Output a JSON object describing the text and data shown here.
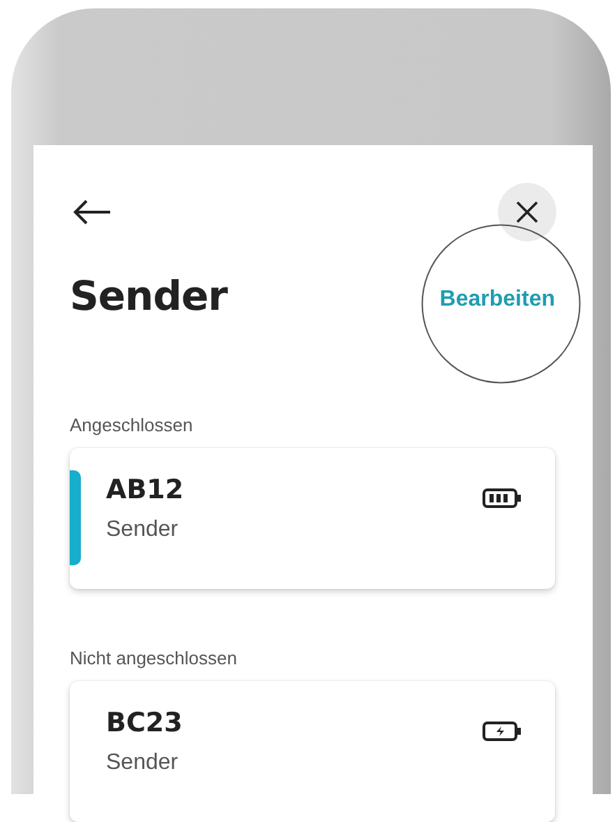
{
  "header": {
    "title": "Sender",
    "edit_action": "Bearbeiten"
  },
  "sections": [
    {
      "label": "Angeschlossen",
      "devices": [
        {
          "name": "AB12",
          "type": "Sender",
          "kind": "battery-full",
          "selected": true
        }
      ]
    },
    {
      "label": "Nicht angeschlossen",
      "devices": [
        {
          "name": "BC23",
          "type": "Sender",
          "kind": "battery-charging",
          "selected": false
        }
      ]
    }
  ]
}
